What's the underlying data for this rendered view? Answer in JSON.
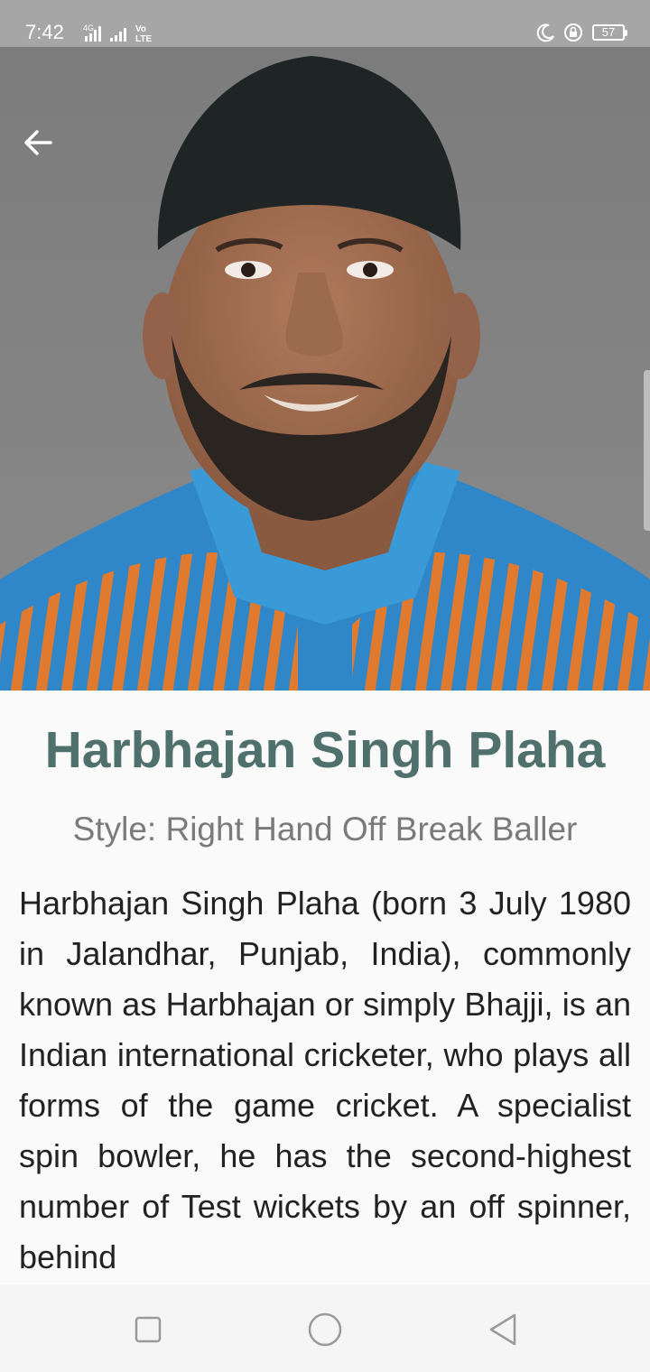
{
  "status_bar": {
    "time": "7:42",
    "network_label": "4G",
    "volte_label": "Vo LTE",
    "battery_level": "57",
    "icons": [
      "signal-icon",
      "volte-icon",
      "moon-icon",
      "rotation-lock-icon",
      "battery-icon"
    ]
  },
  "hero": {
    "image": "player-portrait",
    "back_icon": "arrow-left-icon"
  },
  "player": {
    "name": "Harbhajan Singh Plaha",
    "style": "Style: Right Hand Off Break Baller",
    "bio": "Harbhajan Singh Plaha (born 3 July 1980 in Jalandhar, Punjab, India), commonly known as Harbhajan or simply Bhajji, is an Indian international cricketer, who plays all forms of the game cricket. A specialist spin bowler, he has the second-highest number of Test wickets by an off spinner, behind"
  },
  "nav_bar": {
    "icons": [
      "square-recents-icon",
      "circle-home-icon",
      "triangle-back-icon"
    ]
  },
  "colors": {
    "status_bar": "#a6a6a6",
    "name_text": "#4f706c",
    "style_text": "#7a7a7a",
    "body_text": "#222222",
    "background": "#fafafa",
    "jersey_blue": "#2f86c8",
    "jersey_orange": "#e07a2e"
  }
}
